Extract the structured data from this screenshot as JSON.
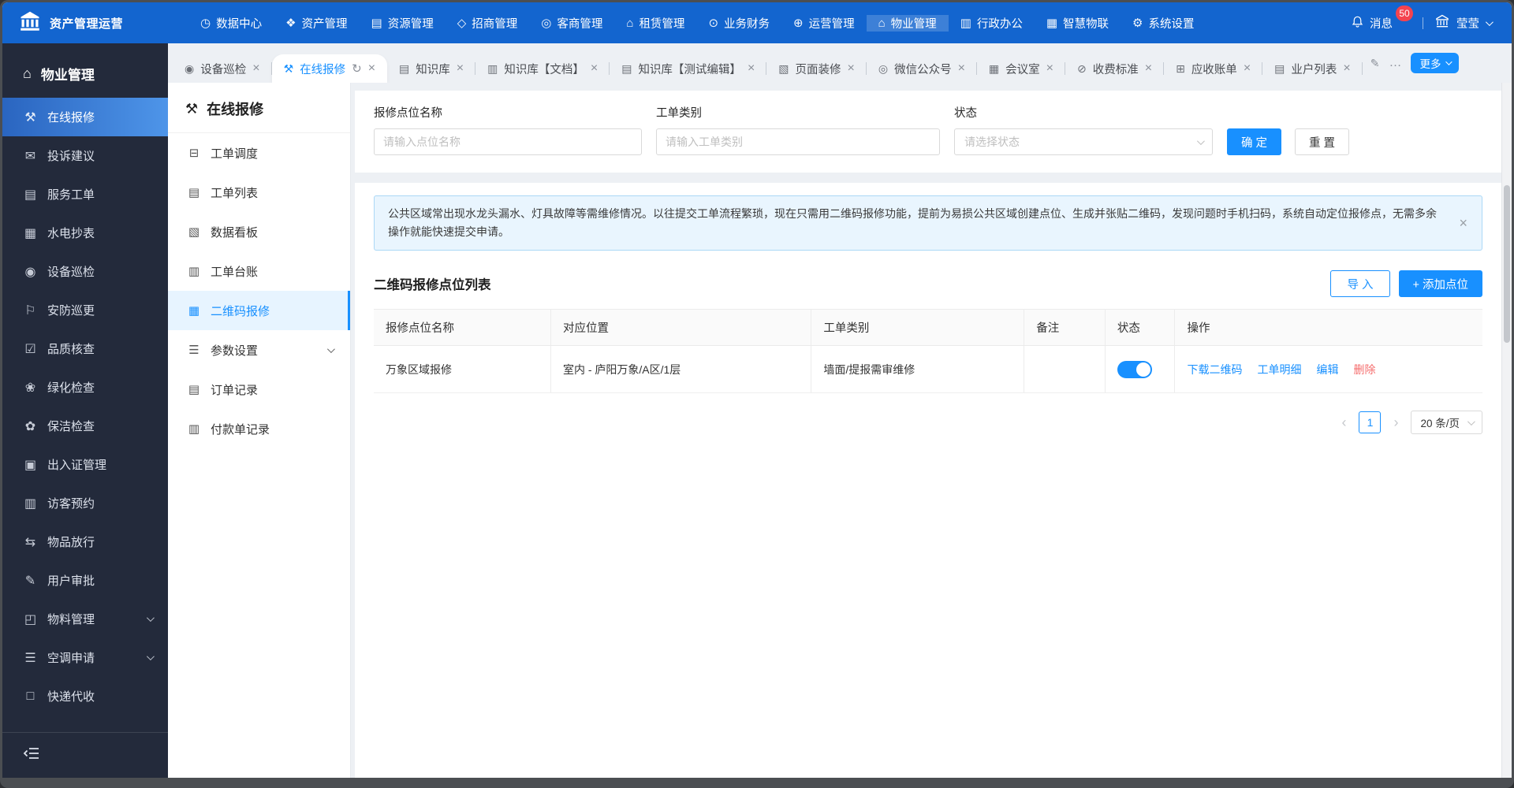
{
  "topbar": {
    "logo_title": "资产管理运营",
    "nav": [
      {
        "id": "data-center",
        "glyph": "◷",
        "label": "数据中心"
      },
      {
        "id": "asset-mgmt",
        "glyph": "❖",
        "label": "资产管理"
      },
      {
        "id": "resource-mgmt",
        "glyph": "▤",
        "label": "资源管理"
      },
      {
        "id": "investment-mgmt",
        "glyph": "◇",
        "label": "招商管理"
      },
      {
        "id": "customer-mgmt",
        "glyph": "◎",
        "label": "客商管理"
      },
      {
        "id": "leasing-mgmt",
        "glyph": "⌂",
        "label": "租赁管理"
      },
      {
        "id": "business-finance",
        "glyph": "⊙",
        "label": "业务财务"
      },
      {
        "id": "operation-mgmt",
        "glyph": "⊕",
        "label": "运营管理"
      },
      {
        "id": "property-mgmt",
        "glyph": "⌂",
        "label": "物业管理",
        "active": true
      },
      {
        "id": "admin-office",
        "glyph": "▥",
        "label": "行政办公"
      },
      {
        "id": "smart-iot",
        "glyph": "▦",
        "label": "智慧物联"
      },
      {
        "id": "system-settings",
        "glyph": "⚙",
        "label": "系统设置"
      }
    ],
    "messages": {
      "label": "消息",
      "badge": "50"
    },
    "user": {
      "name": "莹莹"
    }
  },
  "sidebar": {
    "header": {
      "glyph": "⌂",
      "label": "物业管理"
    },
    "items": [
      {
        "id": "online-repair",
        "glyph": "⚒",
        "label": "在线报修",
        "active": true
      },
      {
        "id": "complaints",
        "glyph": "✉",
        "label": "投诉建议"
      },
      {
        "id": "service-orders",
        "glyph": "▤",
        "label": "服务工单"
      },
      {
        "id": "utility-meter",
        "glyph": "▦",
        "label": "水电抄表"
      },
      {
        "id": "equipment-inspection",
        "glyph": "◉",
        "label": "设备巡检"
      },
      {
        "id": "security-patrol",
        "glyph": "⚐",
        "label": "安防巡更"
      },
      {
        "id": "quality-check",
        "glyph": "☑",
        "label": "品质核查"
      },
      {
        "id": "greening-check",
        "glyph": "❀",
        "label": "绿化检查"
      },
      {
        "id": "cleaning-check",
        "glyph": "✿",
        "label": "保洁检查"
      },
      {
        "id": "pass-mgmt",
        "glyph": "▣",
        "label": "出入证管理"
      },
      {
        "id": "visitor-booking",
        "glyph": "▥",
        "label": "访客预约"
      },
      {
        "id": "item-release",
        "glyph": "⇆",
        "label": "物品放行"
      },
      {
        "id": "user-approval",
        "glyph": "✎",
        "label": "用户审批"
      },
      {
        "id": "material-mgmt",
        "glyph": "◰",
        "label": "物料管理",
        "chevron": true
      },
      {
        "id": "ac-application",
        "glyph": "☰",
        "label": "空调申请",
        "chevron": true
      },
      {
        "id": "courier-collection",
        "glyph": "□",
        "label": "快递代收"
      }
    ]
  },
  "tabbar": {
    "tabs": [
      {
        "id": "equipment-inspection",
        "glyph": "◉",
        "label": "设备巡检"
      },
      {
        "id": "online-repair",
        "glyph": "⚒",
        "label": "在线报修",
        "active": true,
        "refresh": "↻"
      },
      {
        "id": "knowledge-base",
        "glyph": "▤",
        "label": "知识库"
      },
      {
        "id": "knowledge-docs",
        "glyph": "▥",
        "label": "知识库【文档】"
      },
      {
        "id": "knowledge-test-edit",
        "glyph": "▤",
        "label": "知识库【测试编辑】"
      },
      {
        "id": "page-decoration",
        "glyph": "▧",
        "label": "页面装修"
      },
      {
        "id": "wechat-official",
        "glyph": "◎",
        "label": "微信公众号"
      },
      {
        "id": "meeting-room",
        "glyph": "▦",
        "label": "会议室"
      },
      {
        "id": "fee-standard",
        "glyph": "⊘",
        "label": "收费标准"
      },
      {
        "id": "receivable-bills",
        "glyph": "⊞",
        "label": "应收账单"
      },
      {
        "id": "owner-list",
        "glyph": "▤",
        "label": "业户列表"
      }
    ],
    "overflow_glyph": "✎",
    "ellipsis": "…",
    "more_label": "更多"
  },
  "submenu": {
    "header": {
      "glyph": "⚒",
      "label": "在线报修"
    },
    "items": [
      {
        "id": "work-order-dispatch",
        "glyph": "⊟",
        "label": "工单调度"
      },
      {
        "id": "work-order-list",
        "glyph": "▤",
        "label": "工单列表"
      },
      {
        "id": "data-dashboard",
        "glyph": "▧",
        "label": "数据看板"
      },
      {
        "id": "work-order-ledger",
        "glyph": "▥",
        "label": "工单台账"
      },
      {
        "id": "qr-repair",
        "glyph": "▦",
        "label": "二维码报修",
        "active": true
      },
      {
        "id": "parameter-settings",
        "glyph": "☰",
        "label": "参数设置",
        "chevron": true
      },
      {
        "id": "order-records",
        "glyph": "▤",
        "label": "订单记录"
      },
      {
        "id": "payment-records",
        "glyph": "▥",
        "label": "付款单记录"
      }
    ]
  },
  "filters": {
    "fields": [
      {
        "label": "报修点位名称",
        "placeholder": "请输入点位名称"
      },
      {
        "label": "工单类别",
        "placeholder": "请输入工单类别"
      },
      {
        "label": "状态",
        "placeholder": "请选择状态"
      }
    ],
    "submit_label": "确 定",
    "reset_label": "重 置"
  },
  "banner": {
    "text": "公共区域常出现水龙头漏水、灯具故障等需维修情况。以往提交工单流程繁琐，现在只需用二维码报修功能，提前为易损公共区域创建点位、生成并张贴二维码，发现问题时手机扫码，系统自动定位报修点，无需多余操作就能快速提交申请。",
    "close_glyph": "×"
  },
  "section": {
    "title": "二维码报修点位列表",
    "import_label": "导 入",
    "add_label": "+ 添加点位"
  },
  "table": {
    "headers": [
      "报修点位名称",
      "对应位置",
      "工单类别",
      "备注",
      "状态",
      "操作"
    ],
    "rows": [
      {
        "name": "万象区域报修",
        "location": "室内 - 庐阳万象/A区/1层",
        "category": "墙面/提报需审维修",
        "remark": "",
        "status_on": true,
        "actions": [
          "下载二维码",
          "工单明细",
          "编辑",
          "删除"
        ]
      }
    ]
  },
  "pagination": {
    "prev": "‹",
    "page": "1",
    "next": "›",
    "page_size": "20 条/页"
  },
  "colors": {
    "primary": "#1890ff",
    "topbar_blue": "#1365cf",
    "sidebar_dark": "#232a3b",
    "badge_red": "#f4434f",
    "danger_red": "#f56c6c",
    "banner_bg": "#e9f5fe",
    "banner_border": "#abd8f6"
  }
}
